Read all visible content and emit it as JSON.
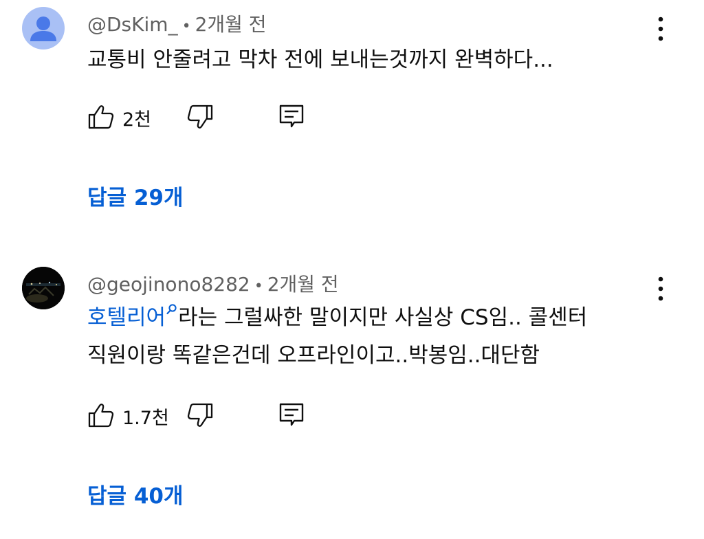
{
  "comments": [
    {
      "author": "@DsKim_",
      "time": "2개월 전",
      "text": "교통비 안줄려고 막차 전에 보내는것까지 완벽하다...",
      "likes": "2천",
      "replies": "답글 29개",
      "avatar": "default-person-icon"
    },
    {
      "author": "@geojinono8282",
      "time": "2개월 전",
      "link_text": "호텔리어",
      "text_line1": "라는 그럴싸한 말이지만 사실상 CS임.. 콜센터",
      "text_line2": "직원이랑 똑같은건데 오프라인이고..박봉임..대단함",
      "likes": "1.7천",
      "replies": "답글 40개",
      "avatar": "night-photo"
    }
  ],
  "separator": "•",
  "colors": {
    "text": "#0f0f0f",
    "meta": "#606060",
    "link": "#065fd4",
    "avatar_default": "#a9c0f5"
  }
}
